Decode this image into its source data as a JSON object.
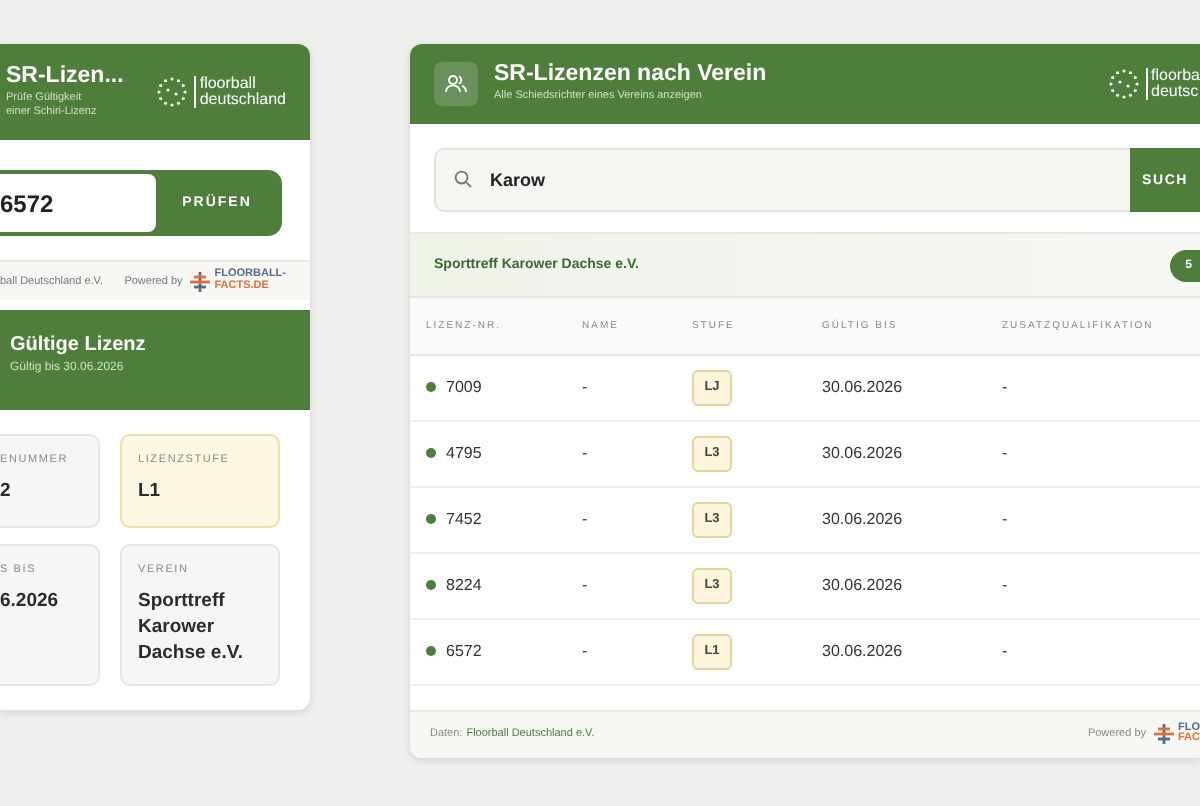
{
  "license_check_panel": {
    "header": {
      "title": "SR-Lizen...",
      "subtitle": "Prüfe Gültigkeit einer Schiri-Lizenz",
      "logo_text": [
        "floorball",
        "deutschland"
      ]
    },
    "license_input": {
      "value": "6572"
    },
    "check_button": "PRÜFEN",
    "footer": {
      "source": "ball Deutschland e.V.",
      "powered_by": "Powered by",
      "partner_logo": [
        "FLOORBALL-",
        "FACTS.DE"
      ]
    },
    "status": {
      "valid": true,
      "title": "Gültige Lizenz",
      "valid_until": "Gültig bis 30.06.2026"
    },
    "fields": [
      {
        "label": "ENUMMER",
        "value": "2",
        "highlighted": false
      },
      {
        "label": "LIZENZSTUFE",
        "value": "L1",
        "highlighted": true
      },
      {
        "label": "S BIS",
        "value": "6.2026",
        "highlighted": false
      },
      {
        "label": "VEREIN",
        "value": "Sporttreff Karower Dachse e.V.",
        "highlighted": false
      }
    ]
  },
  "club_panel": {
    "header": {
      "title": "SR-Lizenzen nach Verein",
      "subtitle": "Alle Schiedsrichter eines Vereins anzeigen",
      "logo_text": [
        "floorba",
        "deutsc"
      ]
    },
    "search": {
      "value": "Karow"
    },
    "search_button": "SUCH",
    "club": {
      "name": "Sporttreff Karower Dachse e.V.",
      "count_badge": "5"
    },
    "table": {
      "columns": [
        "LIZENZ-NR.",
        "NAME",
        "STUFE",
        "GÜLTIG BIS",
        "ZUSATZQUALIFIKATION"
      ],
      "rows": [
        {
          "license_no": "7009",
          "active": true,
          "name": "-",
          "level": "LJ",
          "valid_until": "30.06.2026",
          "qualification": "-"
        },
        {
          "license_no": "4795",
          "active": true,
          "name": "-",
          "level": "L3",
          "valid_until": "30.06.2026",
          "qualification": "-"
        },
        {
          "license_no": "7452",
          "active": true,
          "name": "-",
          "level": "L3",
          "valid_until": "30.06.2026",
          "qualification": "-"
        },
        {
          "license_no": "8224",
          "active": true,
          "name": "-",
          "level": "L3",
          "valid_until": "30.06.2026",
          "qualification": "-"
        },
        {
          "license_no": "6572",
          "active": true,
          "name": "-",
          "level": "L1",
          "valid_until": "30.06.2026",
          "qualification": "-"
        }
      ]
    },
    "footer": {
      "source_label": "Daten:",
      "source_link": "Floorball Deutschland e.V.",
      "powered_by": "Powered by",
      "partner_logo": [
        "FLO",
        "FAC"
      ]
    }
  }
}
